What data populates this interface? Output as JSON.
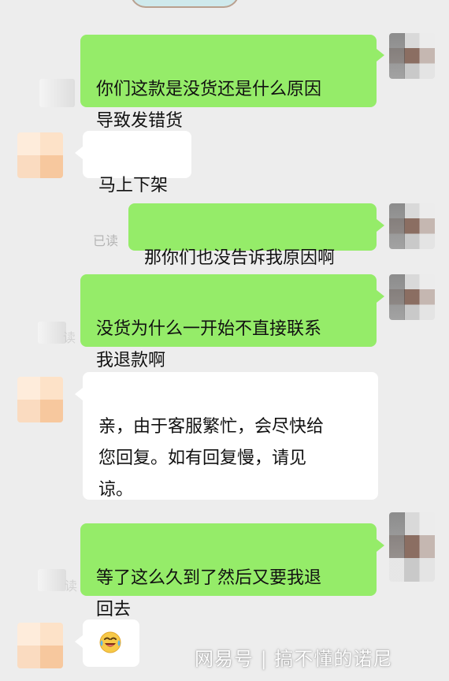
{
  "messages": [
    {
      "side": "out",
      "text": "你们这款是没货还是什么原因\n导致发错货"
    },
    {
      "side": "in",
      "text": "马上下架"
    },
    {
      "side": "out",
      "text": "那你们也没告诉我原因啊",
      "status": "已读"
    },
    {
      "side": "out",
      "text": "没货为什么一开始不直接联系\n我退款啊",
      "status": "读"
    },
    {
      "side": "in",
      "text": "亲，由于客服繁忙，会尽快给\n您回复。如有回复慢，请见\n谅。"
    },
    {
      "side": "out",
      "text": "等了这么久到了然后又要我退\n回去",
      "status": "读"
    },
    {
      "side": "in",
      "emoji": "laughing-crying-emoji"
    }
  ],
  "watermark": "网易号 | 搞不懂的诺尼",
  "colors": {
    "background": "#ededed",
    "outgoing_bubble": "#95ec69",
    "incoming_bubble": "#ffffff",
    "read_status": "#b5b5b5"
  }
}
